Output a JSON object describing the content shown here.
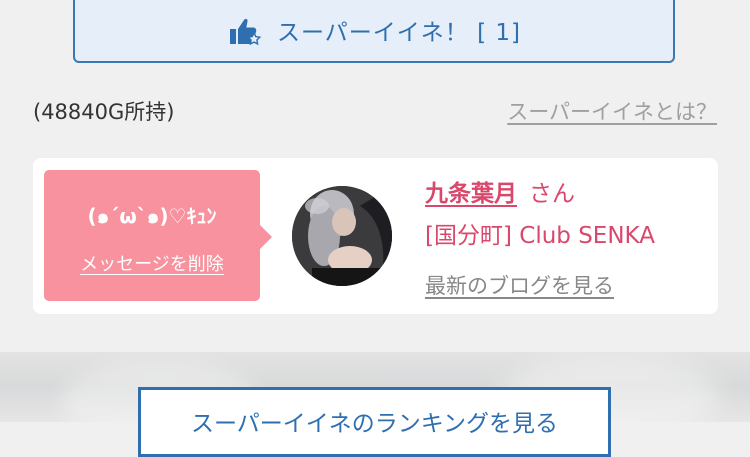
{
  "super_like": {
    "label": "スーパーイイネ！ [ 1]",
    "icon": "thumbs-up-star-icon",
    "color": "#2f6fb0"
  },
  "points": {
    "text": "(48840G所持)"
  },
  "about_link": {
    "label": "スーパーイイネとは？"
  },
  "message_card": {
    "message": "(๑´ω`๑)♡ｷｭﾝ",
    "delete_label": "メッセージを削除",
    "bubble_color": "#f7929e"
  },
  "profile": {
    "name": "九条葉月",
    "honorific": "さん",
    "shop": "[国分町] Club SENKA",
    "blog_link": "最新のブログを見る",
    "accent_color": "#d9486c"
  },
  "ranking_button": {
    "label": "スーパーイイネのランキングを見る"
  }
}
